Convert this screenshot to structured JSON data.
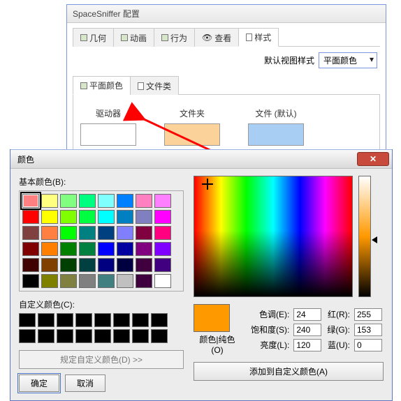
{
  "config": {
    "title": "SpaceSniffer 配置",
    "tabs": [
      {
        "label": "几何"
      },
      {
        "label": "动画"
      },
      {
        "label": "行为"
      },
      {
        "label": "查看"
      },
      {
        "label": "样式",
        "active": true
      }
    ],
    "default_style_label": "默认视图样式",
    "default_style_value": "平面颜色",
    "subtabs": [
      {
        "label": "平面颜色",
        "active": true
      },
      {
        "label": "文件类"
      }
    ],
    "swatches": {
      "drive": {
        "label": "驱动器",
        "color": "#ff9900"
      },
      "folder": {
        "label": "文件夹",
        "color": "#fbd39a"
      },
      "file": {
        "label": "文件 (默认)",
        "color": "#a9cef4"
      }
    }
  },
  "picker": {
    "title": "颜色",
    "basic_label": "基本颜色(B):",
    "custom_label": "自定义颜色(C):",
    "define_custom": "规定自定义颜色(D) >>",
    "ok": "确定",
    "cancel": "取消",
    "solid_label": "颜色|纯色(O)",
    "add_custom": "添加到自定义颜色(A)",
    "fields": {
      "hue_label": "色调(E):",
      "hue": "24",
      "sat_label": "饱和度(S):",
      "sat": "240",
      "lum_label": "亮度(L):",
      "lum": "120",
      "red_label": "红(R):",
      "red": "255",
      "green_label": "绿(G):",
      "green": "153",
      "blue_label": "蓝(U):",
      "blue": "0"
    },
    "selected_color": "#ff9900",
    "basic_colors": [
      "#ff8080",
      "#ffff80",
      "#80ff80",
      "#00ff80",
      "#80ffff",
      "#0080ff",
      "#ff80c0",
      "#ff80ff",
      "#ff0000",
      "#ffff00",
      "#80ff00",
      "#00ff40",
      "#00ffff",
      "#0080c0",
      "#8080c0",
      "#ff00ff",
      "#804040",
      "#ff8040",
      "#00ff00",
      "#008080",
      "#004080",
      "#8080ff",
      "#800040",
      "#ff0080",
      "#800000",
      "#ff8000",
      "#008000",
      "#008040",
      "#0000ff",
      "#0000a0",
      "#800080",
      "#8000ff",
      "#400000",
      "#804000",
      "#004000",
      "#004040",
      "#000080",
      "#000040",
      "#400040",
      "#400080",
      "#000000",
      "#808000",
      "#808040",
      "#808080",
      "#408080",
      "#c0c0c0",
      "#400040",
      "#ffffff"
    ],
    "custom_colors": [
      "#000000",
      "#000000",
      "#000000",
      "#000000",
      "#000000",
      "#000000",
      "#000000",
      "#000000",
      "#000000",
      "#000000",
      "#000000",
      "#000000",
      "#000000",
      "#000000",
      "#000000",
      "#000000"
    ]
  }
}
